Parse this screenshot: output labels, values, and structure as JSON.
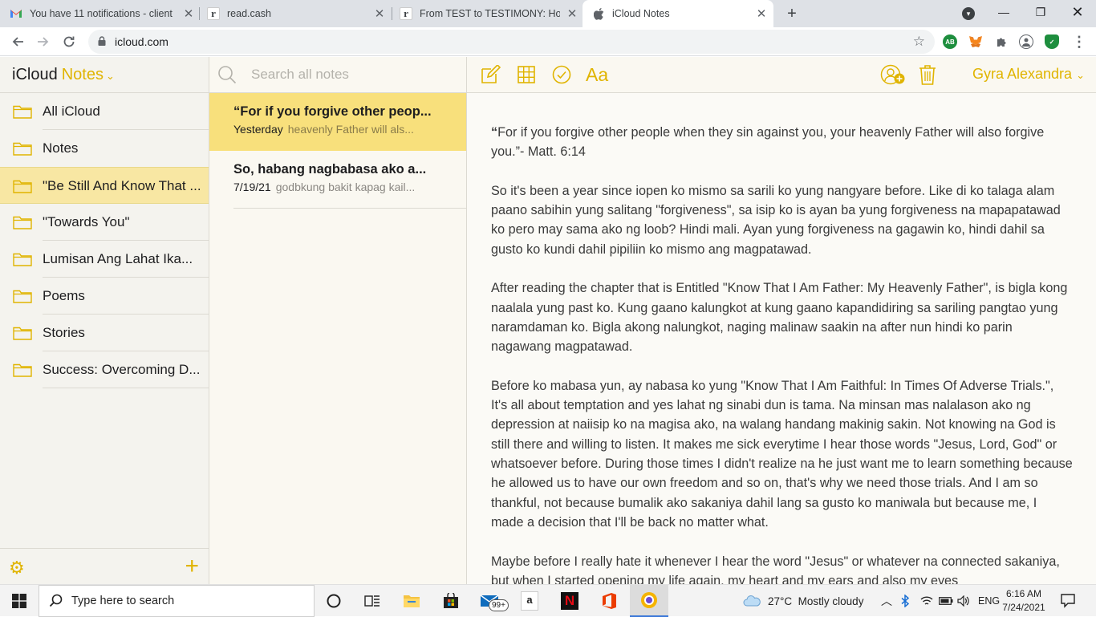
{
  "browser": {
    "tabs": [
      {
        "title": "You have 11 notifications - client",
        "favicon": "gmail-icon"
      },
      {
        "title": "read.cash",
        "favicon": "readcash-icon"
      },
      {
        "title": "From TEST to TESTIMONY: How G",
        "favicon": "readcash-icon"
      },
      {
        "title": "iCloud Notes",
        "favicon": "apple-icon"
      }
    ],
    "url": "icloud.com",
    "profile_badge": "AB"
  },
  "app": {
    "brand_prefix": "iCloud",
    "brand_name": "Notes",
    "folders": [
      {
        "label": "All iCloud"
      },
      {
        "label": "Notes"
      },
      {
        "label": "\"Be Still And Know That ..."
      },
      {
        "label": "\"Towards You\""
      },
      {
        "label": "Lumisan Ang Lahat Ika..."
      },
      {
        "label": "Poems"
      },
      {
        "label": "Stories"
      },
      {
        "label": "Success: Overcoming D..."
      }
    ],
    "selected_folder": 2,
    "search_placeholder": "Search all notes",
    "notes": [
      {
        "title": "“For if you forgive other peop...",
        "date": "Yesterday",
        "preview": "heavenly Father will als..."
      },
      {
        "title": "So, habang nagbabasa ako a...",
        "date": "7/19/21",
        "preview": "godbkung bakit kapag kail..."
      }
    ],
    "user_name": "Gyra Alexandra",
    "accent_color": "#e0b400",
    "editor": {
      "paragraphs": [
        {
          "lead": "“",
          "text": "For if you forgive other people when they sin against you, your heavenly Father will also forgive you.”- Matt. 6:14"
        },
        {
          "lead": "",
          "text": "So it's been a year since iopen ko mismo sa sarili ko yung nangyare before. Like di ko talaga alam paano sabihin yung salitang \"forgiveness\", sa isip ko is ayan ba yung forgiveness na mapapatawad ko pero may sama ako ng loob? Hindi mali. Ayan yung forgiveness na gagawin ko, hindi dahil sa gusto ko kundi dahil pipiliin ko mismo ang magpatawad."
        },
        {
          "lead": "",
          "text": "After reading the chapter that is Entitled \"Know That I Am Father: My Heavenly Father\", is bigla kong naalala yung past ko. Kung gaano kalungkot at kung gaano kapandidiring sa sariling pangtao yung naramdaman ko. Bigla akong nalungkot, naging malinaw saakin na after nun hindi ko parin nagawang magpatawad."
        },
        {
          "lead": "",
          "text": "Before ko mabasa yun, ay nabasa ko yung \"Know That I Am Faithful: In Times Of Adverse Trials.\", It's all about temptation and yes lahat ng sinabi dun is tama. Na minsan mas nalalason ako ng depression at naiisip ko na magisa ako, na walang handang makinig sakin. Not knowing na God is still there and willing to listen. It makes me sick everytime I hear those words \"Jesus, Lord, God\" or whatsoever before. During those times I didn't realize na he just want me to learn something because he allowed us to have our own freedom and so on, that's why we need those trials. And I am so thankful, not because bumalik ako sakaniya dahil lang sa gusto ko maniwala but because me, I made a decision that I'll be back no matter what."
        },
        {
          "lead": "",
          "text": "Maybe before I really hate it whenever I hear the word \"Jesus\" or whatever na connected sakaniya, but when I started opening my life again, my heart and my ears and also my eyes"
        }
      ]
    }
  },
  "taskbar": {
    "search_text": "Type here to search",
    "mail_badge": "99+",
    "weather": "27°C  Mostly cloudy",
    "language": "ENG",
    "time": "6:16 AM",
    "date": "7/24/2021"
  }
}
